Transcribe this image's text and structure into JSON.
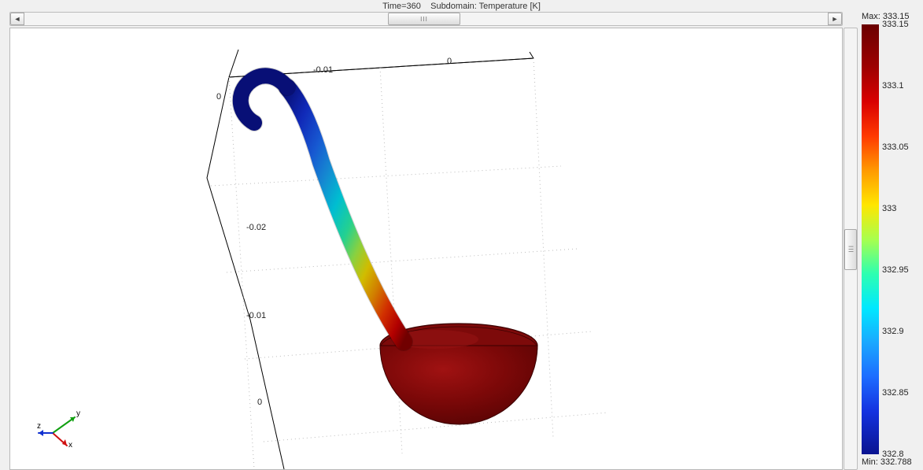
{
  "title": {
    "time_label": "Time=360",
    "subdomain_label": "Subdomain: Temperature [K]"
  },
  "scroll": {
    "h_thumb": "III",
    "v_thumb": "III",
    "arrow_left": "◄",
    "arrow_right": "►"
  },
  "axes": {
    "top_tick_labels": [
      "-0.01",
      "0"
    ],
    "left_tick_labels_top": "0",
    "left_tick_labels_mid1": "-0.02",
    "left_tick_labels_mid2": "-0.01",
    "left_tick_labels_bottom": "0"
  },
  "triad": {
    "x": "x",
    "y": "y",
    "z": "z"
  },
  "legend": {
    "max_label": "Max: 333.15",
    "min_label": "Min: 332.788",
    "ticks": [
      {
        "value": "333.15",
        "frac": 0.0
      },
      {
        "value": "333.1",
        "frac": 0.143
      },
      {
        "value": "333.05",
        "frac": 0.286
      },
      {
        "value": "333",
        "frac": 0.429
      },
      {
        "value": "332.95",
        "frac": 0.571
      },
      {
        "value": "332.9",
        "frac": 0.714
      },
      {
        "value": "332.85",
        "frac": 0.857
      },
      {
        "value": "332.8",
        "frac": 1.0
      }
    ],
    "gradient_stops": [
      {
        "offset": "0%",
        "color": "#6b0000"
      },
      {
        "offset": "10%",
        "color": "#9e0000"
      },
      {
        "offset": "18%",
        "color": "#d90000"
      },
      {
        "offset": "26%",
        "color": "#ff3a00"
      },
      {
        "offset": "34%",
        "color": "#ff9a00"
      },
      {
        "offset": "42%",
        "color": "#ffe600"
      },
      {
        "offset": "50%",
        "color": "#a8ff4e"
      },
      {
        "offset": "58%",
        "color": "#2dffb0"
      },
      {
        "offset": "66%",
        "color": "#00e8ff"
      },
      {
        "offset": "74%",
        "color": "#1aa8ff"
      },
      {
        "offset": "82%",
        "color": "#1d6cff"
      },
      {
        "offset": "90%",
        "color": "#1432e0"
      },
      {
        "offset": "100%",
        "color": "#0a1390"
      }
    ]
  },
  "chart_data": {
    "type": "3d-surface-temperature",
    "description": "3-D heat-transfer result on a ladle-shaped geometry. Bowl is hottest; hook end of handle is coolest.",
    "quantity": "Temperature",
    "unit": "K",
    "time": 360,
    "temperature_range": {
      "min": 332.788,
      "max": 333.15
    },
    "colorbar_samples": [
      333.15,
      333.1,
      333.05,
      333.0,
      332.95,
      332.9,
      332.85,
      332.8
    ],
    "axes_extents_approx": {
      "x": [
        -0.02,
        0
      ],
      "y": [
        -0.01,
        0
      ]
    }
  }
}
